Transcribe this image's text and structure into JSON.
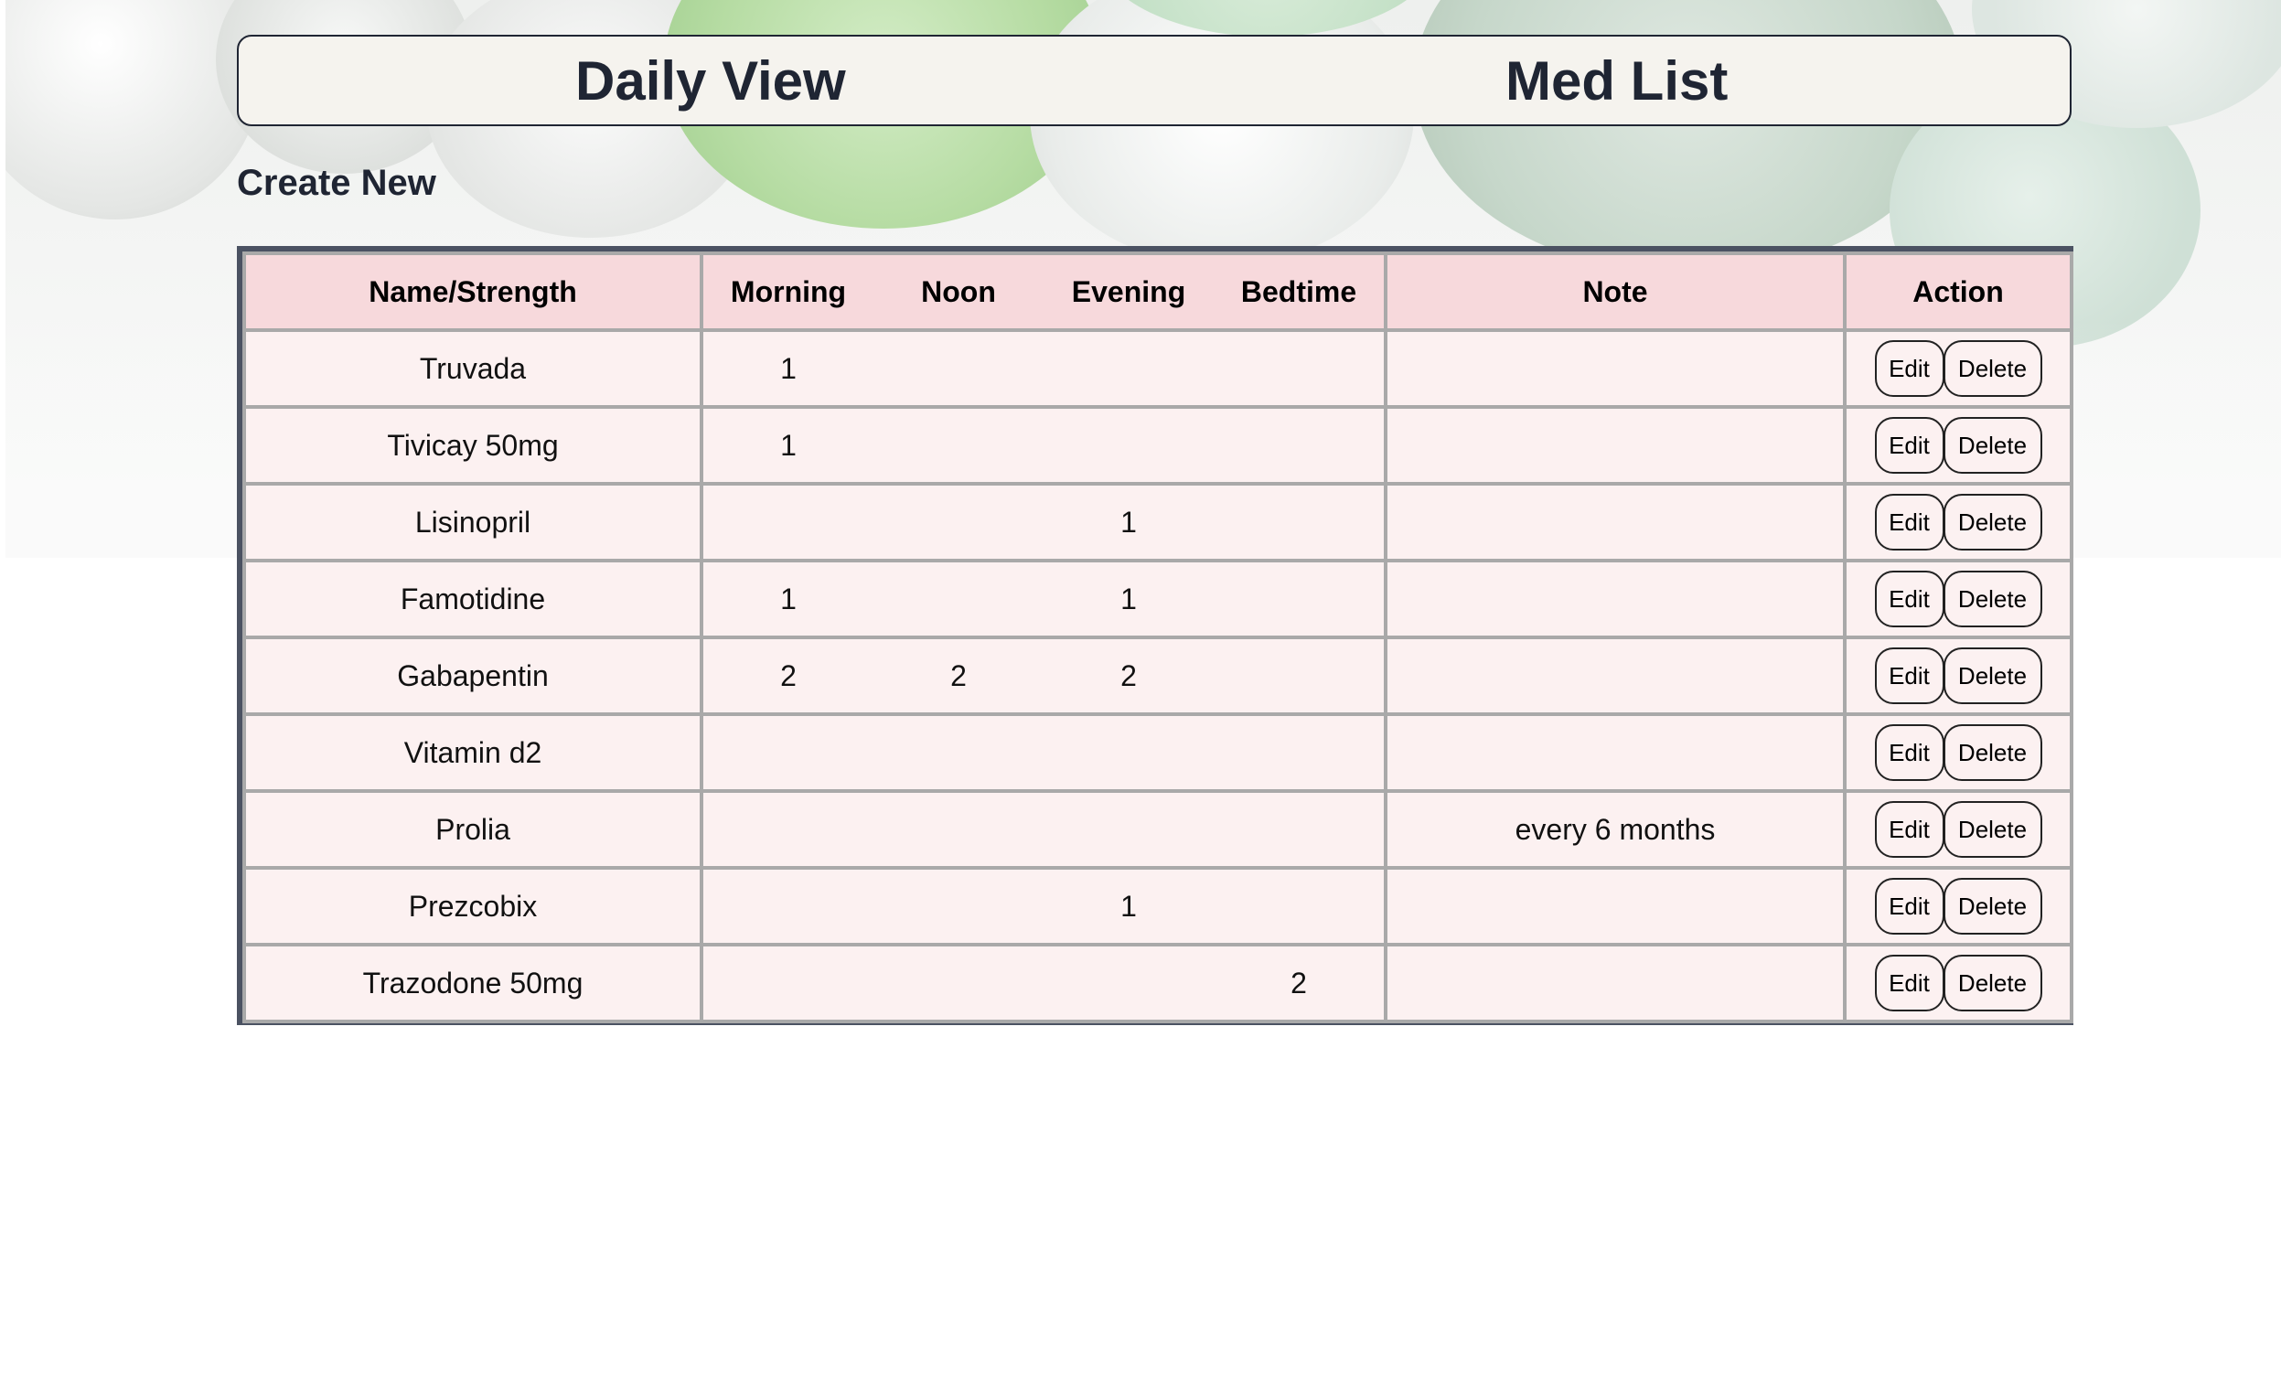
{
  "nav": {
    "daily_view": "Daily View",
    "med_list": "Med List"
  },
  "create_new": "Create New",
  "table": {
    "headers": {
      "name": "Name/Strength",
      "morning": "Morning",
      "noon": "Noon",
      "evening": "Evening",
      "bedtime": "Bedtime",
      "note": "Note",
      "action": "Action"
    },
    "edit_label": "Edit",
    "delete_label": "Delete",
    "rows": [
      {
        "name": "Truvada",
        "morning": "1",
        "noon": "",
        "evening": "",
        "bedtime": "",
        "note": ""
      },
      {
        "name": "Tivicay 50mg",
        "morning": "1",
        "noon": "",
        "evening": "",
        "bedtime": "",
        "note": ""
      },
      {
        "name": "Lisinopril",
        "morning": "",
        "noon": "",
        "evening": "1",
        "bedtime": "",
        "note": ""
      },
      {
        "name": "Famotidine",
        "morning": "1",
        "noon": "",
        "evening": "1",
        "bedtime": "",
        "note": ""
      },
      {
        "name": "Gabapentin",
        "morning": "2",
        "noon": "2",
        "evening": "2",
        "bedtime": "",
        "note": ""
      },
      {
        "name": "Vitamin d2",
        "morning": "",
        "noon": "",
        "evening": "",
        "bedtime": "",
        "note": ""
      },
      {
        "name": "Prolia",
        "morning": "",
        "noon": "",
        "evening": "",
        "bedtime": "",
        "note": "every 6 months"
      },
      {
        "name": "Prezcobix",
        "morning": "",
        "noon": "",
        "evening": "1",
        "bedtime": "",
        "note": ""
      },
      {
        "name": "Trazodone 50mg",
        "morning": "",
        "noon": "",
        "evening": "",
        "bedtime": "2",
        "note": ""
      }
    ]
  }
}
